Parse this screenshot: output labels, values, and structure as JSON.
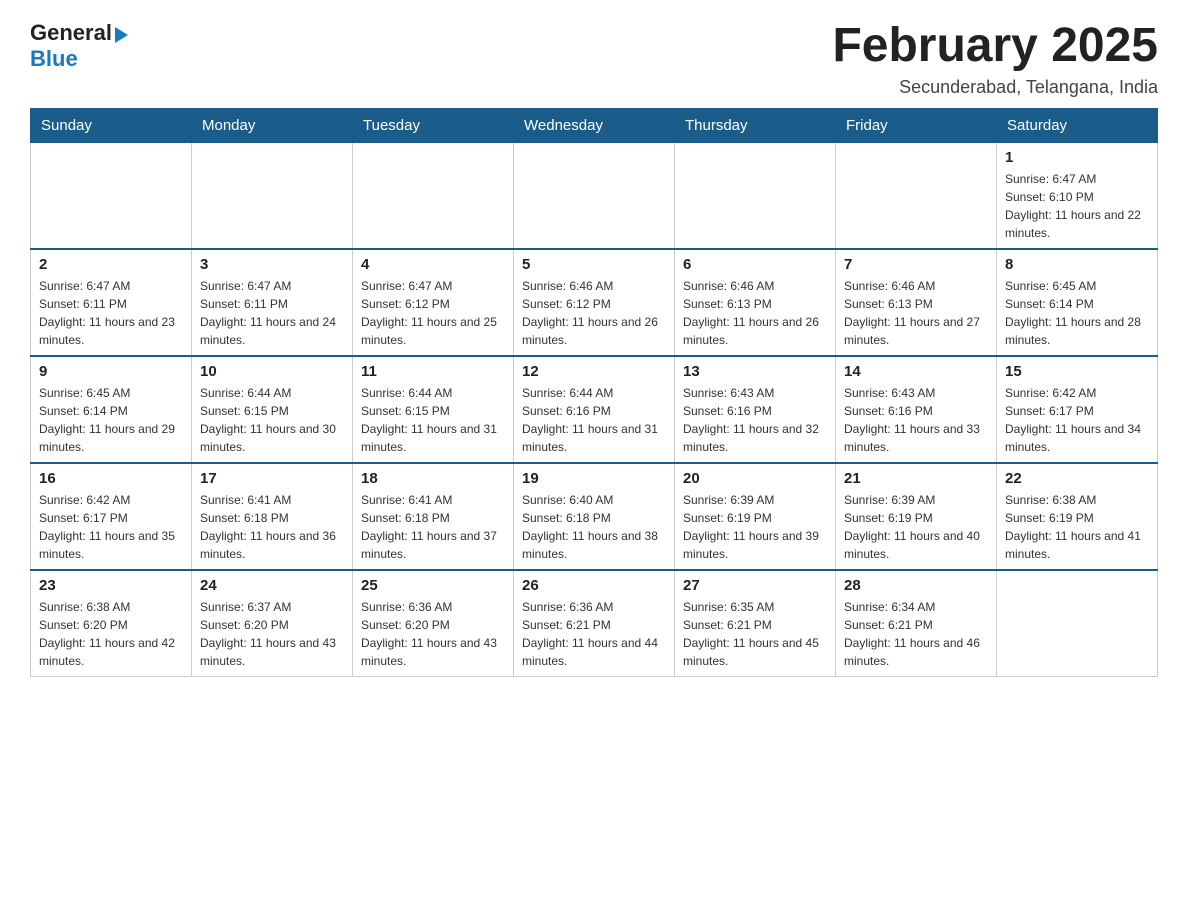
{
  "logo": {
    "general": "General",
    "blue": "Blue"
  },
  "header": {
    "title": "February 2025",
    "subtitle": "Secunderabad, Telangana, India"
  },
  "weekdays": [
    "Sunday",
    "Monday",
    "Tuesday",
    "Wednesday",
    "Thursday",
    "Friday",
    "Saturday"
  ],
  "weeks": [
    [
      {
        "day": "",
        "info": ""
      },
      {
        "day": "",
        "info": ""
      },
      {
        "day": "",
        "info": ""
      },
      {
        "day": "",
        "info": ""
      },
      {
        "day": "",
        "info": ""
      },
      {
        "day": "",
        "info": ""
      },
      {
        "day": "1",
        "info": "Sunrise: 6:47 AM\nSunset: 6:10 PM\nDaylight: 11 hours and 22 minutes."
      }
    ],
    [
      {
        "day": "2",
        "info": "Sunrise: 6:47 AM\nSunset: 6:11 PM\nDaylight: 11 hours and 23 minutes."
      },
      {
        "day": "3",
        "info": "Sunrise: 6:47 AM\nSunset: 6:11 PM\nDaylight: 11 hours and 24 minutes."
      },
      {
        "day": "4",
        "info": "Sunrise: 6:47 AM\nSunset: 6:12 PM\nDaylight: 11 hours and 25 minutes."
      },
      {
        "day": "5",
        "info": "Sunrise: 6:46 AM\nSunset: 6:12 PM\nDaylight: 11 hours and 26 minutes."
      },
      {
        "day": "6",
        "info": "Sunrise: 6:46 AM\nSunset: 6:13 PM\nDaylight: 11 hours and 26 minutes."
      },
      {
        "day": "7",
        "info": "Sunrise: 6:46 AM\nSunset: 6:13 PM\nDaylight: 11 hours and 27 minutes."
      },
      {
        "day": "8",
        "info": "Sunrise: 6:45 AM\nSunset: 6:14 PM\nDaylight: 11 hours and 28 minutes."
      }
    ],
    [
      {
        "day": "9",
        "info": "Sunrise: 6:45 AM\nSunset: 6:14 PM\nDaylight: 11 hours and 29 minutes."
      },
      {
        "day": "10",
        "info": "Sunrise: 6:44 AM\nSunset: 6:15 PM\nDaylight: 11 hours and 30 minutes."
      },
      {
        "day": "11",
        "info": "Sunrise: 6:44 AM\nSunset: 6:15 PM\nDaylight: 11 hours and 31 minutes."
      },
      {
        "day": "12",
        "info": "Sunrise: 6:44 AM\nSunset: 6:16 PM\nDaylight: 11 hours and 31 minutes."
      },
      {
        "day": "13",
        "info": "Sunrise: 6:43 AM\nSunset: 6:16 PM\nDaylight: 11 hours and 32 minutes."
      },
      {
        "day": "14",
        "info": "Sunrise: 6:43 AM\nSunset: 6:16 PM\nDaylight: 11 hours and 33 minutes."
      },
      {
        "day": "15",
        "info": "Sunrise: 6:42 AM\nSunset: 6:17 PM\nDaylight: 11 hours and 34 minutes."
      }
    ],
    [
      {
        "day": "16",
        "info": "Sunrise: 6:42 AM\nSunset: 6:17 PM\nDaylight: 11 hours and 35 minutes."
      },
      {
        "day": "17",
        "info": "Sunrise: 6:41 AM\nSunset: 6:18 PM\nDaylight: 11 hours and 36 minutes."
      },
      {
        "day": "18",
        "info": "Sunrise: 6:41 AM\nSunset: 6:18 PM\nDaylight: 11 hours and 37 minutes."
      },
      {
        "day": "19",
        "info": "Sunrise: 6:40 AM\nSunset: 6:18 PM\nDaylight: 11 hours and 38 minutes."
      },
      {
        "day": "20",
        "info": "Sunrise: 6:39 AM\nSunset: 6:19 PM\nDaylight: 11 hours and 39 minutes."
      },
      {
        "day": "21",
        "info": "Sunrise: 6:39 AM\nSunset: 6:19 PM\nDaylight: 11 hours and 40 minutes."
      },
      {
        "day": "22",
        "info": "Sunrise: 6:38 AM\nSunset: 6:19 PM\nDaylight: 11 hours and 41 minutes."
      }
    ],
    [
      {
        "day": "23",
        "info": "Sunrise: 6:38 AM\nSunset: 6:20 PM\nDaylight: 11 hours and 42 minutes."
      },
      {
        "day": "24",
        "info": "Sunrise: 6:37 AM\nSunset: 6:20 PM\nDaylight: 11 hours and 43 minutes."
      },
      {
        "day": "25",
        "info": "Sunrise: 6:36 AM\nSunset: 6:20 PM\nDaylight: 11 hours and 43 minutes."
      },
      {
        "day": "26",
        "info": "Sunrise: 6:36 AM\nSunset: 6:21 PM\nDaylight: 11 hours and 44 minutes."
      },
      {
        "day": "27",
        "info": "Sunrise: 6:35 AM\nSunset: 6:21 PM\nDaylight: 11 hours and 45 minutes."
      },
      {
        "day": "28",
        "info": "Sunrise: 6:34 AM\nSunset: 6:21 PM\nDaylight: 11 hours and 46 minutes."
      },
      {
        "day": "",
        "info": ""
      }
    ]
  ]
}
